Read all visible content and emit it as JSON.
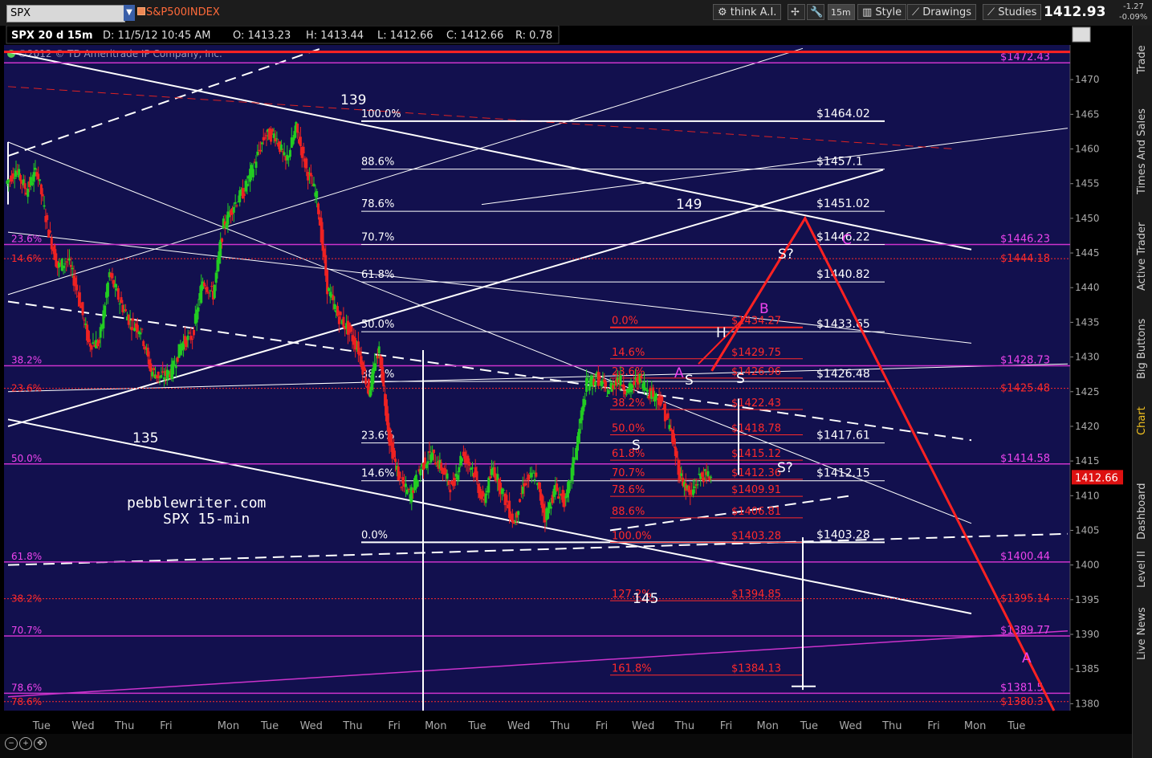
{
  "toolbar": {
    "symbol": "SPX",
    "description": "S&P500INDEX",
    "think_ai": "think A.I.",
    "interval": "15m",
    "style": "Style",
    "drawings": "Drawings",
    "studies": "Studies",
    "last_price": "1412.93",
    "change_abs": "-1.27",
    "change_pct": "-0.09%"
  },
  "sidebar": {
    "tabs": [
      "Trade",
      "Times And Sales",
      "Active Trader",
      "Big Buttons",
      "Chart",
      "Dashboard",
      "Level II",
      "Live News"
    ],
    "active_tab": "Chart"
  },
  "colors": {
    "background": "#12104e",
    "up_candle": "#22cc22",
    "down_candle": "#ee2222",
    "fib_white": "#ffffff",
    "fib_red": "#ff2a2a",
    "magenta": "#cc33cc",
    "label_magenta": "#ee44ee",
    "price_tag": "#dd1111"
  },
  "chart_data": {
    "type": "line",
    "header": {
      "title": "SPX 20 d 15m",
      "datetime": "D: 11/5/12 10:45 AM",
      "open": "O: 1413.23",
      "high": "H: 1413.44",
      "low": "L: 1412.66",
      "close": "C: 1412.66",
      "range": "R: 0.78"
    },
    "copyright": "©2012 © TD Ameritrade IP Company, Inc.",
    "annotation_site": "pebblewriter.com",
    "annotation_desc": "SPX 15-min",
    "current_price": "1412.66",
    "ylim": [
      1379,
      1475
    ],
    "y_ticks": [
      1380,
      1385,
      1390,
      1395,
      1400,
      1405,
      1410,
      1415,
      1420,
      1425,
      1430,
      1435,
      1440,
      1445,
      1450,
      1455,
      1460,
      1465,
      1470
    ],
    "x_tick_labels": [
      "Tue",
      "Wed",
      "Thu",
      "Fri",
      "Mon",
      "Tue",
      "Wed",
      "Thu",
      "Fri",
      "Mon",
      "Tue",
      "Wed",
      "Thu",
      "Fri",
      "Wed",
      "Thu",
      "Fri",
      "Mon",
      "Tue",
      "Wed",
      "Thu",
      "Fri",
      "Mon",
      "Tue"
    ],
    "x_tick_bars": [
      2,
      6,
      10,
      14,
      20,
      24,
      28,
      32,
      36,
      40,
      44,
      48,
      52,
      56,
      60,
      64,
      68,
      72,
      76,
      80,
      84,
      88,
      92,
      96
    ],
    "price_path": [
      [
        0,
        1455
      ],
      [
        1,
        1457
      ],
      [
        2,
        1454
      ],
      [
        3,
        1457
      ],
      [
        4,
        1449
      ],
      [
        5,
        1443
      ],
      [
        6,
        1444
      ],
      [
        7,
        1439
      ],
      [
        8,
        1432
      ],
      [
        9,
        1432
      ],
      [
        10,
        1442
      ],
      [
        11,
        1438
      ],
      [
        12,
        1435
      ],
      [
        13,
        1434
      ],
      [
        14,
        1428
      ],
      [
        15,
        1427
      ],
      [
        16,
        1428
      ],
      [
        17,
        1432
      ],
      [
        18,
        1433
      ],
      [
        19,
        1441
      ],
      [
        20,
        1439
      ],
      [
        21,
        1449
      ],
      [
        22,
        1452
      ],
      [
        23,
        1454
      ],
      [
        24,
        1458
      ],
      [
        25,
        1462
      ],
      [
        26,
        1462
      ],
      [
        27,
        1458
      ],
      [
        28,
        1463
      ],
      [
        29,
        1457
      ],
      [
        30,
        1453
      ],
      [
        31,
        1440
      ],
      [
        32,
        1436
      ],
      [
        33,
        1434
      ],
      [
        34,
        1431
      ],
      [
        35,
        1425
      ],
      [
        36,
        1431
      ],
      [
        37,
        1418
      ],
      [
        38,
        1412
      ],
      [
        39,
        1410
      ],
      [
        40,
        1414
      ],
      [
        41,
        1416
      ],
      [
        42,
        1414
      ],
      [
        43,
        1411
      ],
      [
        44,
        1416
      ],
      [
        45,
        1414
      ],
      [
        46,
        1409
      ],
      [
        47,
        1414
      ],
      [
        48,
        1410
      ],
      [
        49,
        1406
      ],
      [
        50,
        1412
      ],
      [
        51,
        1413
      ],
      [
        52,
        1407
      ],
      [
        53,
        1411
      ],
      [
        54,
        1409
      ],
      [
        55,
        1417
      ],
      [
        56,
        1426
      ],
      [
        57,
        1427
      ],
      [
        58,
        1425
      ],
      [
        59,
        1427
      ],
      [
        60,
        1425
      ],
      [
        61,
        1427
      ],
      [
        62,
        1425
      ],
      [
        63,
        1424
      ],
      [
        64,
        1420
      ],
      [
        65,
        1413
      ],
      [
        66,
        1410
      ],
      [
        67,
        1413
      ],
      [
        68,
        1412.66
      ]
    ],
    "fib_levels_white": [
      {
        "pct": "100.0%",
        "price": "$1464.02",
        "value": 1464.02
      },
      {
        "pct": "88.6%",
        "price": "$1457.1",
        "value": 1457.1
      },
      {
        "pct": "78.6%",
        "price": "$1451.02",
        "value": 1451.02
      },
      {
        "pct": "70.7%",
        "price": "$1446.22",
        "value": 1446.22
      },
      {
        "pct": "61.8%",
        "price": "$1440.82",
        "value": 1440.82
      },
      {
        "pct": "50.0%",
        "price": "$1433.65",
        "value": 1433.65
      },
      {
        "pct": "38.2%",
        "price": "$1426.48",
        "value": 1426.48
      },
      {
        "pct": "23.6%",
        "price": "$1417.61",
        "value": 1417.61
      },
      {
        "pct": "14.6%",
        "price": "$1412.15",
        "value": 1412.15
      },
      {
        "pct": "0.0%",
        "price": "$1403.28",
        "value": 1403.28
      }
    ],
    "fib_levels_red": [
      {
        "pct": "0.0%",
        "price": "$1434.27",
        "value": 1434.27
      },
      {
        "pct": "14.6%",
        "price": "$1429.75",
        "value": 1429.75
      },
      {
        "pct": "23.6%",
        "price": "$1426.96",
        "value": 1426.96
      },
      {
        "pct": "38.2%",
        "price": "$1422.43",
        "value": 1422.43
      },
      {
        "pct": "50.0%",
        "price": "$1418.78",
        "value": 1418.78
      },
      {
        "pct": "61.8%",
        "price": "$1415.12",
        "value": 1415.12
      },
      {
        "pct": "70.7%",
        "price": "$1412.36",
        "value": 1412.36
      },
      {
        "pct": "78.6%",
        "price": "$1409.91",
        "value": 1409.91
      },
      {
        "pct": "88.6%",
        "price": "$1406.81",
        "value": 1406.81
      },
      {
        "pct": "100.0%",
        "price": "$1403.28",
        "value": 1403.28
      },
      {
        "pct": "127.2%",
        "price": "$1394.85",
        "value": 1394.85
      },
      {
        "pct": "161.8%",
        "price": "$1384.13",
        "value": 1384.13
      }
    ],
    "magenta_levels": [
      {
        "pct": "",
        "price": "$1472.43",
        "value": 1472.43
      },
      {
        "pct": "23.6%",
        "price": "$1446.23",
        "value": 1446.23
      },
      {
        "pct": "38.2%",
        "price": "$1428.73",
        "value": 1428.73
      },
      {
        "pct": "50.0%",
        "price": "$1414.58",
        "value": 1414.58
      },
      {
        "pct": "61.8%",
        "price": "$1400.44",
        "value": 1400.44
      },
      {
        "pct": "70.7%",
        "price": "$1389.77",
        "value": 1389.77
      },
      {
        "pct": "78.6%",
        "price": "$1381.5",
        "value": 1381.5
      }
    ],
    "red_left_levels": [
      {
        "pct": "14.6%",
        "price": "$1444.18",
        "value": 1444.18
      },
      {
        "pct": "23.6%",
        "price": "$1425.48",
        "value": 1425.48
      },
      {
        "pct": "38.2%",
        "price": "$1395.14",
        "value": 1395.14
      },
      {
        "pct": "78.6%",
        "price": "$1380.3",
        "value": 1380.3
      }
    ],
    "wave_labels_white": [
      "139",
      "149",
      "135",
      "145",
      "H",
      "S",
      "S",
      "S",
      "S?",
      "S?"
    ],
    "wave_labels_magenta": [
      "A",
      "B",
      "C",
      "A"
    ],
    "projection_path": [
      [
        68,
        1428
      ],
      [
        77,
        1450
      ],
      [
        101,
        1379
      ]
    ]
  }
}
